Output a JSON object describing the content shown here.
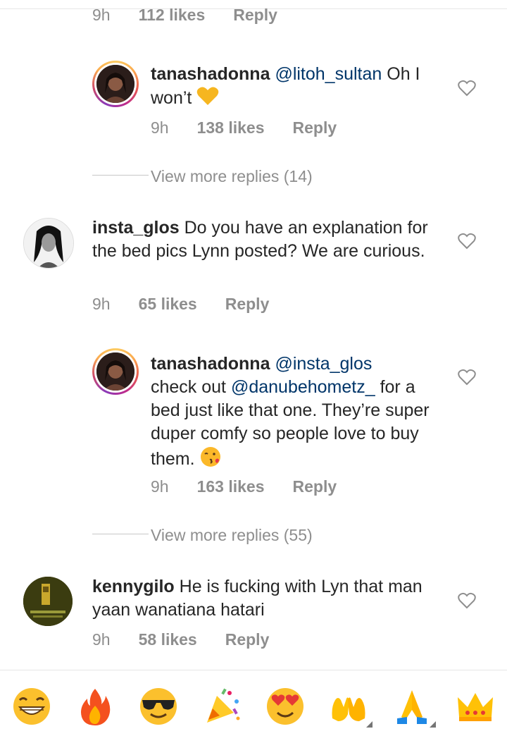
{
  "comments": [
    {
      "meta": {
        "time": "9h",
        "likes": "112 likes",
        "reply": "Reply"
      }
    },
    {
      "username": "tanashadonna",
      "mention": "@litoh_sultan",
      "text": " Oh I won’t ",
      "meta": {
        "time": "9h",
        "likes": "138 likes",
        "reply": "Reply"
      }
    },
    {
      "view_more": "View more replies (14)"
    },
    {
      "username": "insta_glos",
      "text": " Do you have an explanation for the bed pics Lynn posted? We are curious.",
      "meta": {
        "time": "9h",
        "likes": "65 likes",
        "reply": "Reply"
      }
    },
    {
      "username": "tanashadonna",
      "mention": "@insta_glos",
      "text_line2_prefix": "check out ",
      "mention2": "@danubehometz_",
      "text_rest": " for a bed just like that one. They’re super duper comfy so people love to buy them. ",
      "meta": {
        "time": "9h",
        "likes": "163 likes",
        "reply": "Reply"
      }
    },
    {
      "view_more": "View more replies (55)"
    },
    {
      "username": "kennygilo",
      "text": " He is fucking with Lyn that man yaan wanatiana hatari",
      "meta": {
        "time": "9h",
        "likes": "58 likes",
        "reply": "Reply"
      }
    }
  ],
  "emoji_bar": [
    "grinning-face",
    "fire",
    "smiling-face-with-sunglasses",
    "party-popper",
    "heart-eyes",
    "raising-hands",
    "folded-hands",
    "crown"
  ],
  "colors": {
    "mention": "#003569",
    "meta": "#8e8e8e",
    "text": "#262626"
  }
}
